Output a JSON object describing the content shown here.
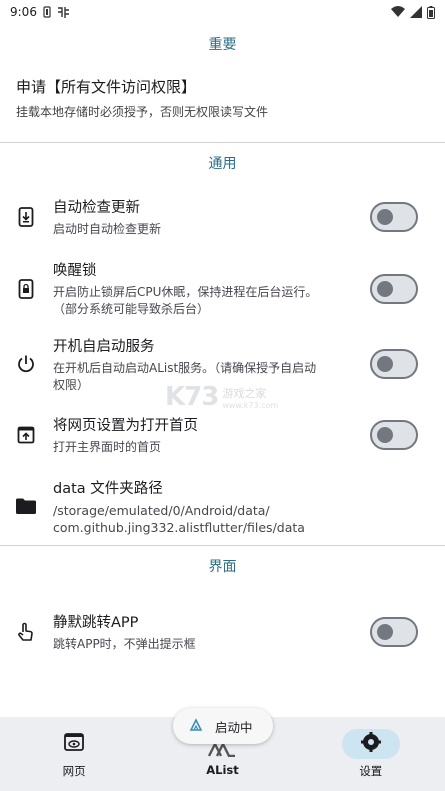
{
  "status_bar": {
    "time": "9:06"
  },
  "sections": {
    "important": "重要",
    "general": "通用",
    "interface": "界面"
  },
  "permission": {
    "title": "申请【所有文件访问权限】",
    "desc": "挂载本地存储时必须授予，否则无权限读写文件"
  },
  "settings": [
    {
      "title": "自动检查更新",
      "desc": "启动时自动检查更新",
      "icon": "update-icon",
      "enabled": false
    },
    {
      "title": "唤醒锁",
      "desc": "开启防止锁屏后CPU休眠，保持进程在后台运行。\n（部分系统可能导致杀后台）",
      "icon": "lock-icon",
      "enabled": false
    },
    {
      "title": "开机自启动服务",
      "desc": "在开机后自动启动AList服务。（请确保授予自启动\n权限）",
      "icon": "power-icon",
      "enabled": false
    },
    {
      "title": "将网页设置为打开首页",
      "desc": "打开主界面时的首页",
      "icon": "open-in-new-icon",
      "enabled": false
    },
    {
      "title": "data 文件夹路径",
      "desc": "/storage/emulated/0/Android/data/\ncom.github.jing332.alistflutter/files/data",
      "icon": "folder-icon"
    }
  ],
  "interface_settings": [
    {
      "title": "静默跳转APP",
      "desc": "跳转APP时，不弹出提示框",
      "icon": "touch-icon",
      "enabled": false
    }
  ],
  "nav": {
    "web": "网页",
    "alist": "AList",
    "settings": "设置"
  },
  "toast": {
    "text": "启动中"
  },
  "watermark": {
    "logo": "K73",
    "cn": "游戏之家",
    "url": "www.k73.com"
  },
  "colors": {
    "accent": "#2a6f86",
    "nav_bg": "#eceef1",
    "active_pill": "#cde5f0"
  }
}
